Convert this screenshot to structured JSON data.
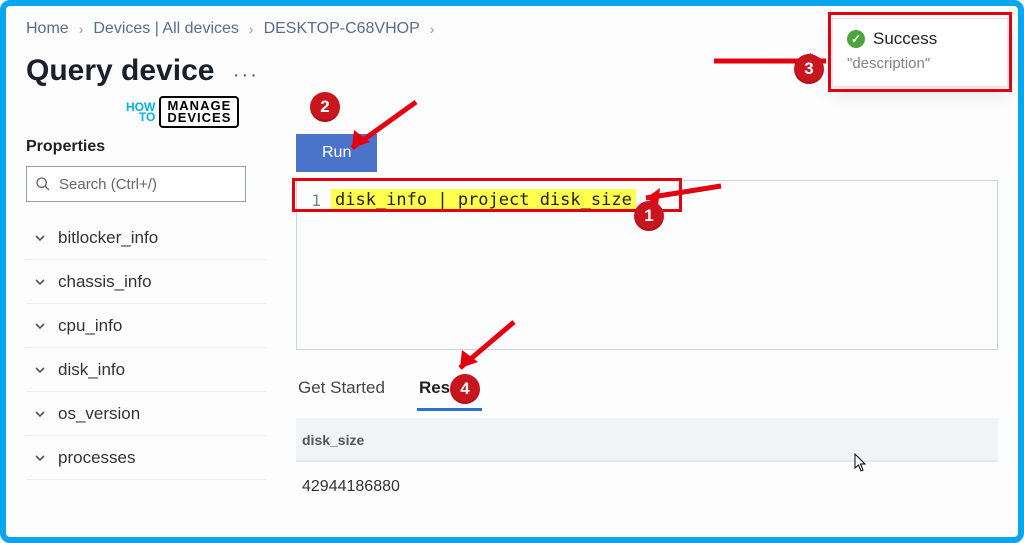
{
  "breadcrumb": {
    "home": "Home",
    "devices": "Devices | All devices",
    "device": "DESKTOP-C68VHOP"
  },
  "title": "Query device",
  "logo": {
    "how": "HOW",
    "to": "TO",
    "manage": "MANAGE",
    "devices": "DEVICES"
  },
  "sidebar": {
    "heading": "Properties",
    "search_placeholder": "Search (Ctrl+/)",
    "items": [
      {
        "label": "bitlocker_info"
      },
      {
        "label": "chassis_info"
      },
      {
        "label": "cpu_info"
      },
      {
        "label": "disk_info"
      },
      {
        "label": "os_version"
      },
      {
        "label": "processes"
      }
    ]
  },
  "run_label": "Run",
  "editor": {
    "line_no": "1",
    "code": "disk_info | project disk_size"
  },
  "tabs": {
    "get_started": "Get Started",
    "results": "Results"
  },
  "results": {
    "column": "disk_size",
    "value": "42944186880"
  },
  "toast": {
    "title": "Success",
    "sub": "\"description\""
  },
  "callouts": {
    "c1": "1",
    "c2": "2",
    "c3": "3",
    "c4": "4"
  },
  "annotation_color": "#e3000f"
}
